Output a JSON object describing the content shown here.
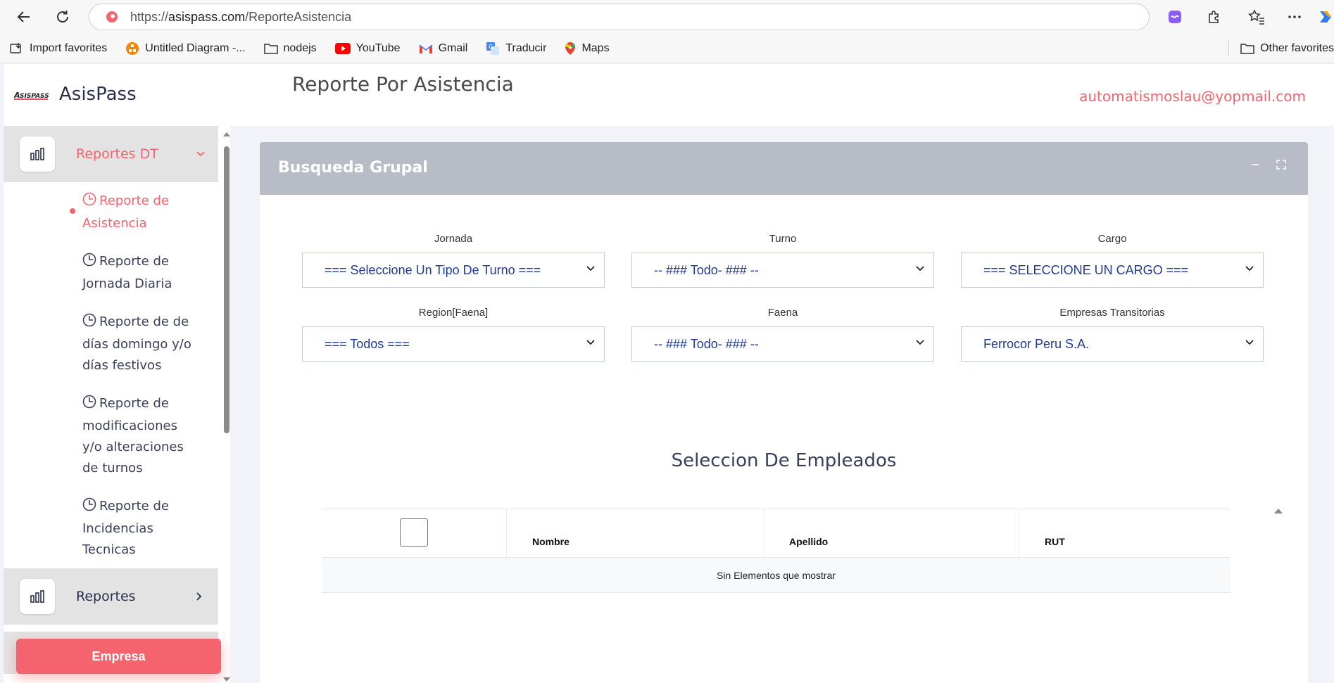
{
  "browser": {
    "url_prefix": "https://",
    "url_domain": "asispass.com",
    "url_path": "/ReporteAsistencia"
  },
  "bookmarks": [
    {
      "label": "Import favorites",
      "icon": "import-icon"
    },
    {
      "label": "Untitled Diagram -...",
      "icon": "drawio-icon"
    },
    {
      "label": "nodejs",
      "icon": "folder-icon"
    },
    {
      "label": "YouTube",
      "icon": "youtube-icon"
    },
    {
      "label": "Gmail",
      "icon": "gmail-icon"
    },
    {
      "label": "Traducir",
      "icon": "translate-icon"
    },
    {
      "label": "Maps",
      "icon": "maps-icon"
    }
  ],
  "other_favorites": "Other favorites",
  "sidebar": {
    "brand": "AsisPass",
    "logo_text": "ASISPASS",
    "group_reportes_dt": "Reportes DT",
    "submenu": [
      {
        "label": "Reporte de Asistencia",
        "active": true
      },
      {
        "label": "Reporte de Jornada Diaria",
        "active": false
      },
      {
        "label": "Reporte de de días domingo y/o días festivos",
        "active": false
      },
      {
        "label": "Reporte de modificaciones y/o alteraciones de turnos",
        "active": false
      },
      {
        "label": "Reporte de Incidencias Tecnicas",
        "active": false
      }
    ],
    "group_reportes": "Reportes",
    "empresa_button": "Empresa"
  },
  "header": {
    "title": "Reporte Por Asistencia",
    "user_email": "automatismoslau@yopmail.com"
  },
  "card": {
    "title": "Busqueda Grupal",
    "filters": {
      "jornada": {
        "label": "Jornada",
        "value": "=== Seleccione Un Tipo De Turno ==="
      },
      "turno": {
        "label": "Turno",
        "value": "-- ### Todo- ### --"
      },
      "cargo": {
        "label": "Cargo",
        "value": "=== SELECCIONE UN CARGO ==="
      },
      "region": {
        "label": "Region[Faena]",
        "value": "=== Todos ==="
      },
      "faena": {
        "label": "Faena",
        "value": "-- ### Todo- ### --"
      },
      "empresas": {
        "label": "Empresas Transitorias",
        "value": "Ferrocor Peru S.A."
      }
    },
    "employees_title": "Seleccion De Empleados",
    "table": {
      "columns": [
        "Nombre",
        "Apellido",
        "RUT"
      ],
      "empty_message": "Sin Elementos que mostrar"
    }
  },
  "colors": {
    "accent": "#f5636e",
    "card_header": "#b8bcc6",
    "select_text": "#1f3a93"
  }
}
